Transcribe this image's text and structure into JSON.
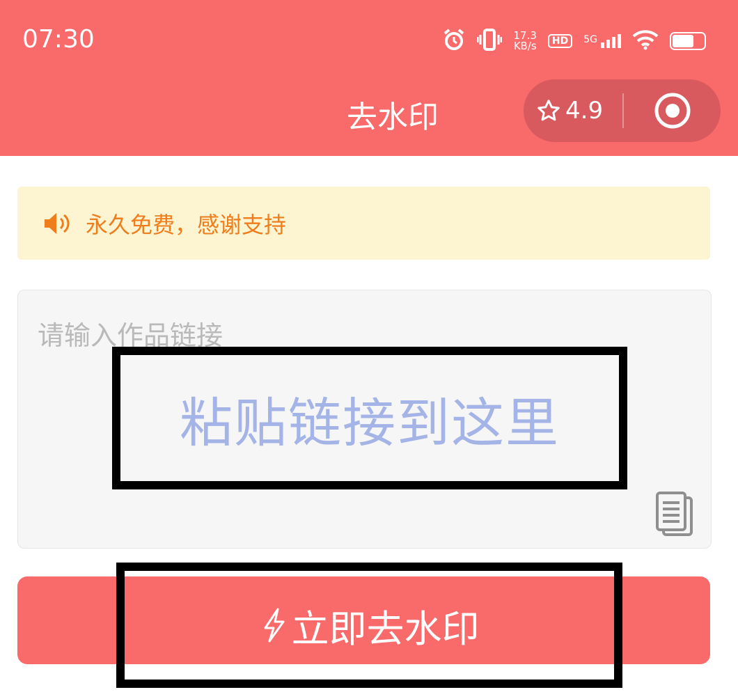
{
  "status_bar": {
    "time": "07:30",
    "net_speed_value": "17.3",
    "net_speed_unit": "KB/s",
    "hd": "HD",
    "network": "5G"
  },
  "header": {
    "title": "去水印",
    "rating": "4.9"
  },
  "notice": {
    "text": "永久免费，感谢支持"
  },
  "input": {
    "placeholder": "请输入作品链接",
    "hint": "粘贴链接到这里"
  },
  "submit": {
    "label": "立即去水印"
  },
  "colors": {
    "brand": "#f96a6a",
    "capsule": "#d95a5e",
    "notice_bg": "#fdf4d1",
    "notice_text": "#ef7d1c",
    "hint_text": "#a5b4e6"
  },
  "icons": [
    "alarm-icon",
    "vibrate-icon",
    "wifi-icon",
    "battery-icon",
    "star-icon",
    "target-icon",
    "speaker-icon",
    "paste-icon",
    "lightning-icon"
  ]
}
